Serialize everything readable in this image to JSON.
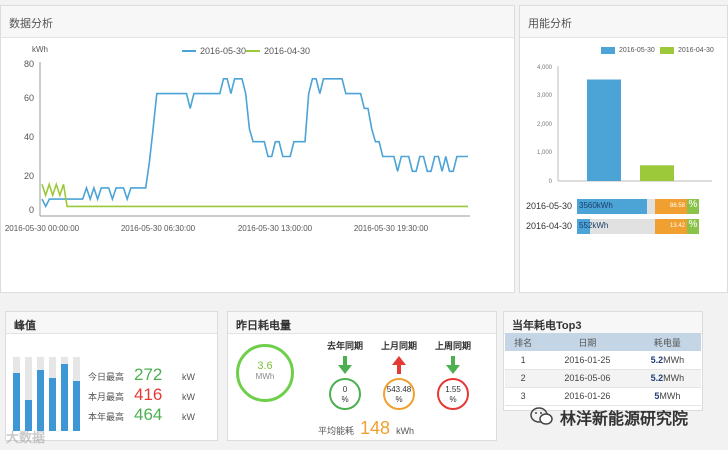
{
  "data_panel": {
    "title": "数据分析"
  },
  "energy_panel": {
    "title": "用能分析"
  },
  "line_chart": {
    "ylabel": "kWh",
    "y_ticks": [
      "80",
      "60",
      "40",
      "20",
      "0"
    ],
    "x_ticks": [
      "2016-05-30 00:00:00",
      "2016-05-30 06:30:00",
      "2016-05-30 13:00:00",
      "2016-05-30 19:30:00"
    ],
    "legend": [
      "2016-05-30",
      "2016-04-30"
    ],
    "colors": [
      "#4ba3d6",
      "#9bc93a"
    ]
  },
  "chart_data": [
    {
      "type": "line",
      "title": "",
      "xlabel": "",
      "ylabel": "kWh",
      "ylim": [
        0,
        80
      ],
      "x_range": [
        "2016-05-30 00:00:00",
        "2016-05-31 00:00:00"
      ],
      "series": [
        {
          "name": "2016-05-30",
          "color": "#4ba3d6",
          "values": [
            7,
            3,
            7,
            7,
            7,
            7,
            7,
            7,
            7,
            7,
            7,
            7,
            13,
            7,
            13,
            7,
            13,
            13,
            13,
            7,
            13,
            13,
            13,
            7,
            13,
            13,
            13,
            13,
            13,
            27,
            45,
            64,
            64,
            64,
            64,
            64,
            64,
            64,
            64,
            64,
            56,
            64,
            64,
            64,
            64,
            64,
            64,
            64,
            64,
            72,
            72,
            64,
            72,
            72,
            72,
            64,
            45,
            38,
            38,
            38,
            38,
            30,
            30,
            38,
            38,
            30,
            30,
            30,
            38,
            38,
            38,
            38,
            64,
            72,
            72,
            64,
            72,
            72,
            72,
            72,
            72,
            72,
            64,
            64,
            64,
            64,
            64,
            56,
            56,
            45,
            38,
            38,
            30,
            30,
            30,
            30,
            22,
            30,
            30,
            30,
            22,
            22,
            30,
            30,
            22,
            22,
            30,
            30,
            22,
            30,
            22,
            22,
            30,
            30,
            30,
            30
          ]
        },
        {
          "name": "2016-04-30",
          "color": "#9bc93a",
          "values": [
            15,
            9,
            15,
            9,
            15,
            9,
            15,
            3,
            3,
            3,
            3,
            3,
            3,
            3,
            3,
            3,
            3,
            3,
            3,
            3,
            3,
            3,
            3,
            3,
            3,
            3,
            3,
            3,
            3,
            3,
            3,
            3,
            3,
            3,
            3,
            3,
            3,
            3,
            3,
            3,
            3,
            3,
            3,
            3,
            3,
            3,
            3,
            3,
            3,
            3,
            3,
            3,
            3,
            3,
            3,
            3,
            3,
            3,
            3,
            3,
            3,
            3,
            3,
            3,
            3,
            3,
            3,
            3,
            3,
            3,
            3,
            3,
            3,
            3,
            3,
            3,
            3,
            3,
            3,
            3,
            3,
            3,
            3,
            3,
            3,
            3,
            3,
            3,
            3,
            3,
            3,
            3,
            3,
            3,
            3,
            3,
            3,
            3,
            3,
            3,
            3,
            3,
            3,
            3,
            3,
            3,
            3,
            3,
            3,
            3,
            3,
            3,
            3,
            3,
            3,
            3,
            3,
            3,
            3,
            3
          ]
        }
      ]
    },
    {
      "type": "bar",
      "title": "",
      "categories": [
        "2016-05-30",
        "2016-04-30"
      ],
      "values": [
        3560,
        552
      ],
      "ylim": [
        0,
        4000
      ],
      "y_ticks": [
        "4,000",
        "3,000",
        "2,000",
        "1,000",
        "0"
      ],
      "colors": [
        "#4ba3d6",
        "#9bc93a"
      ]
    }
  ],
  "energy_bars": [
    {
      "label": "2016-05-30",
      "value_text": "3560kWh",
      "fraction": 0.8,
      "percent_value": "86.58",
      "percent_sign": "%"
    },
    {
      "label": "2016-04-30",
      "value_text": "552kWh",
      "fraction": 0.15,
      "percent_value": "13.42",
      "percent_sign": "%"
    }
  ],
  "peak_panel": {
    "title": "峰值",
    "bars": [
      0.78,
      0.42,
      0.82,
      0.72,
      0.9,
      0.68
    ],
    "rows": [
      {
        "label": "今日最高",
        "value": "272",
        "unit": "kW"
      },
      {
        "label": "本月最高",
        "value": "416",
        "unit": "kW"
      },
      {
        "label": "本年最高",
        "value": "464",
        "unit": "kW"
      }
    ]
  },
  "yesterday_panel": {
    "title": "昨日耗电量",
    "value": "3.6",
    "unit": "MWh",
    "comparisons": [
      {
        "title": "去年同期",
        "value": "0",
        "unit": "%",
        "direction": "down",
        "color": "#4caf50"
      },
      {
        "title": "上月同期",
        "value": "543.48",
        "unit": "%",
        "direction": "up",
        "color": "#e53935"
      },
      {
        "title": "上周同期",
        "value": "1.55",
        "unit": "%",
        "direction": "down",
        "color": "#4caf50"
      }
    ],
    "avg_label": "平均能耗",
    "avg_value": "148",
    "avg_unit": "kWh"
  },
  "top3_panel": {
    "title": "当年耗电Top3",
    "headers": [
      "排名",
      "日期",
      "耗电量"
    ],
    "rows": [
      {
        "rank": "1",
        "date": "2016-01-25",
        "value": "5.2",
        "unit": "MWh"
      },
      {
        "rank": "2",
        "date": "2016-05-06",
        "value": "5.2",
        "unit": "MWh"
      },
      {
        "rank": "3",
        "date": "2016-01-26",
        "value": "5",
        "unit": "MWh"
      }
    ]
  },
  "watermark": "林洋新能源研究院",
  "watermark_left": "大数据"
}
